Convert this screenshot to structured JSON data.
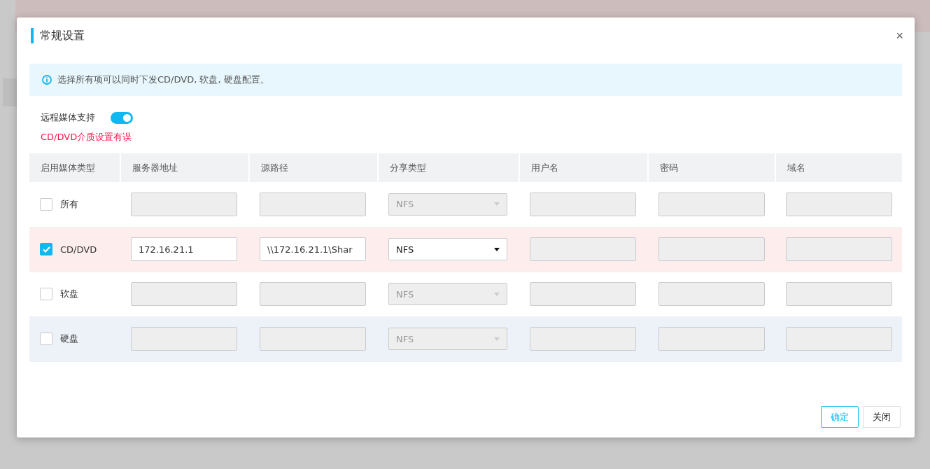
{
  "dialog": {
    "title": "常规设置",
    "close": "×",
    "info": "选择所有项可以同时下发CD/DVD, 软盘, 硬盘配置。",
    "remote_media": {
      "label": "远程媒体支持",
      "on": true
    },
    "error": "CD/DVD介质设置有误",
    "table": {
      "columns": [
        "启用媒体类型",
        "服务器地址",
        "源路径",
        "分享类型",
        "用户名",
        "密码",
        "域名"
      ],
      "rows": [
        {
          "media": "所有",
          "checked": false,
          "error": false,
          "hovered": false,
          "server": "",
          "path": "",
          "share": "NFS",
          "user": "",
          "password": "",
          "domain": ""
        },
        {
          "media": "CD/DVD",
          "checked": true,
          "error": true,
          "hovered": false,
          "server": "172.16.21.1",
          "path": "\\\\172.16.21.1\\Shar",
          "share": "NFS",
          "user": "",
          "password": "",
          "domain": ""
        },
        {
          "media": "软盘",
          "checked": false,
          "error": false,
          "hovered": false,
          "server": "",
          "path": "",
          "share": "NFS",
          "user": "",
          "password": "",
          "domain": ""
        },
        {
          "media": "硬盘",
          "checked": false,
          "error": false,
          "hovered": true,
          "server": "",
          "path": "",
          "share": "NFS",
          "user": "",
          "password": "",
          "domain": ""
        }
      ]
    },
    "buttons": [
      {
        "label": "确定",
        "kind": "primary"
      },
      {
        "label": "关闭",
        "kind": "default"
      }
    ]
  }
}
